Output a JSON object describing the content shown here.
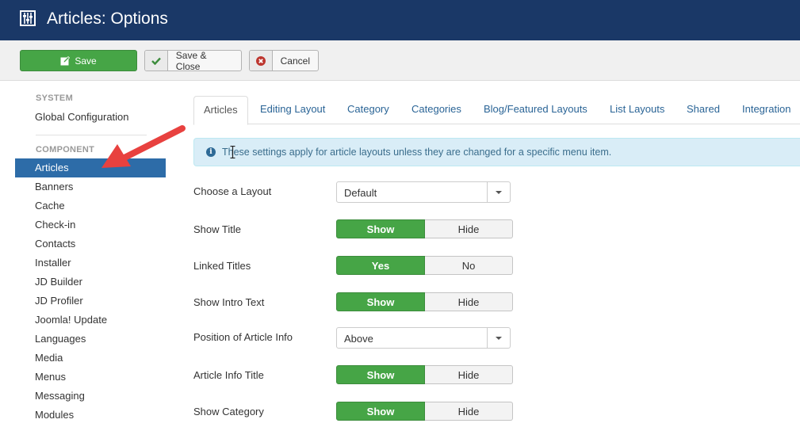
{
  "header": {
    "title": "Articles: Options",
    "icon": "options-sliders-icon"
  },
  "toolbar": {
    "save_label": "Save",
    "save_close_label": "Save & Close",
    "cancel_label": "Cancel"
  },
  "sidebar": {
    "system_heading": "SYSTEM",
    "system_items": [
      {
        "label": "Global Configuration"
      }
    ],
    "component_heading": "COMPONENT",
    "component_items": [
      {
        "label": "Articles",
        "active": true
      },
      {
        "label": "Banners"
      },
      {
        "label": "Cache"
      },
      {
        "label": "Check-in"
      },
      {
        "label": "Contacts"
      },
      {
        "label": "Installer"
      },
      {
        "label": "JD Builder"
      },
      {
        "label": "JD Profiler"
      },
      {
        "label": "Joomla! Update"
      },
      {
        "label": "Languages"
      },
      {
        "label": "Media"
      },
      {
        "label": "Menus"
      },
      {
        "label": "Messaging"
      },
      {
        "label": "Modules"
      }
    ]
  },
  "tabs": [
    {
      "label": "Articles",
      "active": true
    },
    {
      "label": "Editing Layout"
    },
    {
      "label": "Category"
    },
    {
      "label": "Categories"
    },
    {
      "label": "Blog/Featured Layouts"
    },
    {
      "label": "List Layouts"
    },
    {
      "label": "Shared"
    },
    {
      "label": "Integration"
    }
  ],
  "alert": {
    "text": "These settings apply for article layouts unless they are changed for a specific menu item."
  },
  "fields": [
    {
      "label": "Choose a Layout",
      "type": "select",
      "value": "Default"
    },
    {
      "label": "Show Title",
      "type": "toggle",
      "on": "Show",
      "off": "Hide",
      "selected": "Show"
    },
    {
      "label": "Linked Titles",
      "type": "toggle",
      "on": "Yes",
      "off": "No",
      "selected": "Yes"
    },
    {
      "label": "Show Intro Text",
      "type": "toggle",
      "on": "Show",
      "off": "Hide",
      "selected": "Show"
    },
    {
      "label": "Position of Article Info",
      "type": "select",
      "value": "Above"
    },
    {
      "label": "Article Info Title",
      "type": "toggle",
      "on": "Show",
      "off": "Hide",
      "selected": "Show"
    },
    {
      "label": "Show Category",
      "type": "toggle",
      "on": "Show",
      "off": "Hide",
      "selected": "Show"
    }
  ],
  "colors": {
    "header_bg": "#1a3867",
    "success": "#46a546",
    "active_nav": "#2d6ca8",
    "annotation_arrow": "#e8413f"
  }
}
